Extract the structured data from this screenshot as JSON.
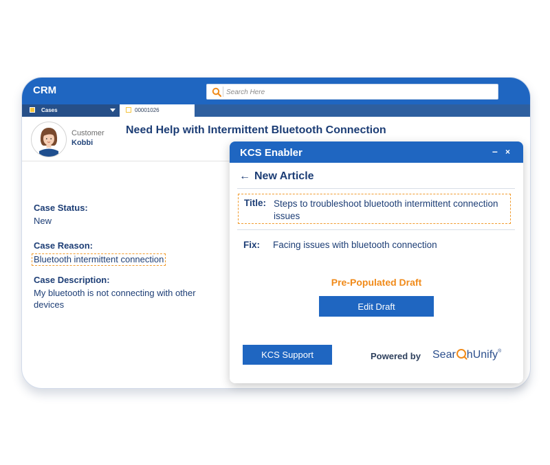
{
  "app": {
    "title": "CRM"
  },
  "search": {
    "placeholder": "Search Here"
  },
  "tabs": {
    "cases_label": "Cases",
    "case_number": "00001026"
  },
  "customer": {
    "label": "Customer",
    "name": "Kobbi"
  },
  "case": {
    "title": "Need Help with Intermittent Bluetooth Connection",
    "status_label": "Case Status:",
    "status_value": "New",
    "reason_label": "Case Reason:",
    "reason_value": "Bluetooth intermittent connection",
    "description_label": "Case Description:",
    "description_value": "My bluetooth is not connecting with other devices"
  },
  "kcs": {
    "title": "KCS Enabler",
    "minimize_icon": "–",
    "close_icon": "×",
    "back_arrow": "←",
    "article_heading": "New Article",
    "title_label": "Title:",
    "title_value": "Steps to troubleshoot bluetooth intermittent connection issues",
    "fix_label": "Fix:",
    "fix_value": "Facing issues with bluetooth connection",
    "draft_label": "Pre-Populated Draft",
    "edit_button": "Edit Draft",
    "support_button": "KCS Support",
    "powered_by": "Powered by",
    "brand_part1": "Sear",
    "brand_part2": "hUnify",
    "brand_tm": "®"
  },
  "colors": {
    "primary": "#1f66c1",
    "text_navy": "#1c3d75",
    "accent_orange": "#f08a19",
    "highlight_dash": "#f19a2b"
  }
}
